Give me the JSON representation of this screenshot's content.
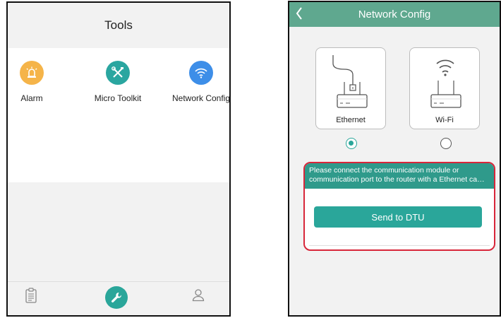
{
  "left_screen": {
    "title": "Tools",
    "tools": [
      {
        "label": "Alarm",
        "icon": "alarm-icon",
        "color": "#f5b449"
      },
      {
        "label": "Micro Toolkit",
        "icon": "wrench-screwdriver-icon",
        "color": "#2aa6a0"
      },
      {
        "label": "Network Config",
        "icon": "wifi-icon",
        "color": "#3d8ee8"
      }
    ],
    "bottom_nav": [
      {
        "icon": "clipboard-icon",
        "active": false
      },
      {
        "icon": "wrench-icon",
        "active": true
      },
      {
        "icon": "user-icon",
        "active": false
      }
    ]
  },
  "right_screen": {
    "title": "Network Config",
    "header_color": "#5fa88f",
    "options": [
      {
        "label": "Ethernet",
        "icon": "ethernet-router-icon",
        "selected": true
      },
      {
        "label": "Wi-Fi",
        "icon": "wifi-router-icon",
        "selected": false
      }
    ],
    "hint": {
      "line1": "Please connect the communication module or",
      "line2": "communication port to the router with a Ethernet ca…"
    },
    "send_button_label": "Send to DTU",
    "accent_color": "#2aa69a",
    "highlight_color": "#d8263a"
  }
}
